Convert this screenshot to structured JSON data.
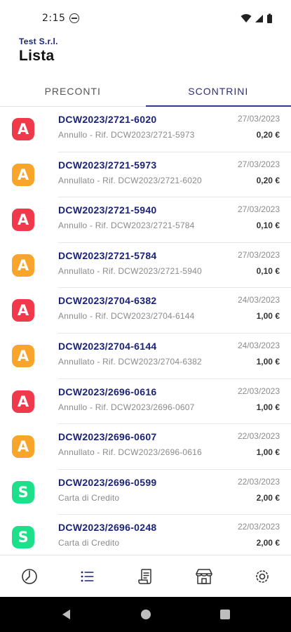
{
  "status_bar": {
    "time": "2:15"
  },
  "header": {
    "company": "Test S.r.l.",
    "title": "Lista"
  },
  "tabs": [
    {
      "label": "PRECONTI",
      "active": false
    },
    {
      "label": "SCONTRINI",
      "active": true
    }
  ],
  "colors": {
    "annullo": "#f03a4c",
    "annullato": "#f9a42a",
    "sale": "#1fe08a",
    "accent": "#1b2377"
  },
  "receipts": [
    {
      "badge": "A",
      "kind": "annullo",
      "code": "DCW2023/2721-6020",
      "desc": "Annullo - Rif. DCW2023/2721-5973",
      "date": "27/03/2023",
      "amount": "0,20 €"
    },
    {
      "badge": "A",
      "kind": "annullato",
      "code": "DCW2023/2721-5973",
      "desc": "Annullato - Rif. DCW2023/2721-6020",
      "date": "27/03/2023",
      "amount": "0,20 €"
    },
    {
      "badge": "A",
      "kind": "annullo",
      "code": "DCW2023/2721-5940",
      "desc": "Annullo - Rif. DCW2023/2721-5784",
      "date": "27/03/2023",
      "amount": "0,10 €"
    },
    {
      "badge": "A",
      "kind": "annullato",
      "code": "DCW2023/2721-5784",
      "desc": "Annullato - Rif. DCW2023/2721-5940",
      "date": "27/03/2023",
      "amount": "0,10 €"
    },
    {
      "badge": "A",
      "kind": "annullo",
      "code": "DCW2023/2704-6382",
      "desc": "Annullo - Rif. DCW2023/2704-6144",
      "date": "24/03/2023",
      "amount": "1,00 €"
    },
    {
      "badge": "A",
      "kind": "annullato",
      "code": "DCW2023/2704-6144",
      "desc": "Annullato - Rif. DCW2023/2704-6382",
      "date": "24/03/2023",
      "amount": "1,00 €"
    },
    {
      "badge": "A",
      "kind": "annullo",
      "code": "DCW2023/2696-0616",
      "desc": "Annullo - Rif. DCW2023/2696-0607",
      "date": "22/03/2023",
      "amount": "1,00 €"
    },
    {
      "badge": "A",
      "kind": "annullato",
      "code": "DCW2023/2696-0607",
      "desc": "Annullato - Rif. DCW2023/2696-0616",
      "date": "22/03/2023",
      "amount": "1,00 €"
    },
    {
      "badge": "S",
      "kind": "sale",
      "code": "DCW2023/2696-0599",
      "desc": "Carta di Credito",
      "date": "22/03/2023",
      "amount": "2,00 €"
    },
    {
      "badge": "S",
      "kind": "sale",
      "code": "DCW2023/2696-0248",
      "desc": "Carta di Credito",
      "date": "22/03/2023",
      "amount": "2,00 €"
    }
  ],
  "bottom_nav": [
    {
      "icon": "dashboard-clock-icon",
      "active": false
    },
    {
      "icon": "list-icon",
      "active": true
    },
    {
      "icon": "receipt-icon",
      "active": false
    },
    {
      "icon": "store-icon",
      "active": false
    },
    {
      "icon": "settings-icon",
      "active": false
    }
  ],
  "system_nav": [
    "back-icon",
    "home-icon",
    "recents-icon"
  ]
}
